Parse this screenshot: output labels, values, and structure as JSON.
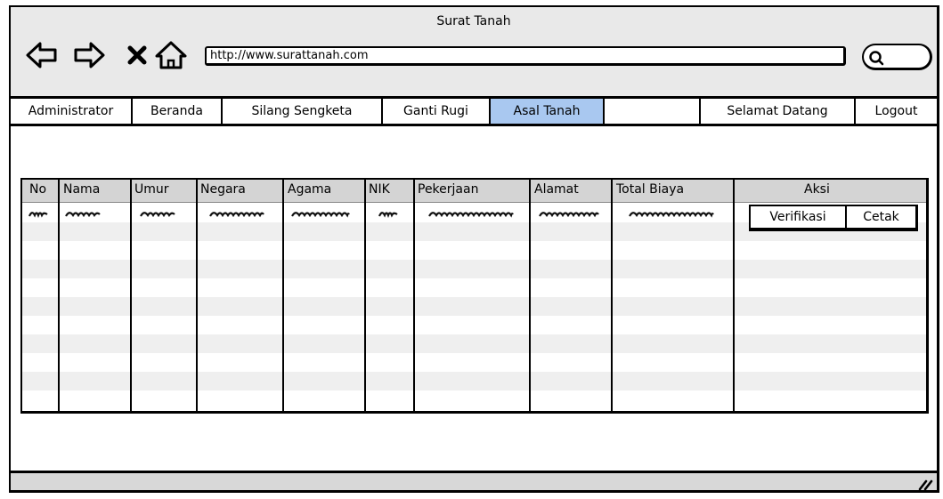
{
  "window": {
    "title": "Surat Tanah"
  },
  "browser": {
    "url": "http://www.surattanah.com",
    "icons": [
      "back-arrow-icon",
      "forward-arrow-icon",
      "close-icon",
      "home-icon",
      "search-icon"
    ]
  },
  "menu": {
    "items": [
      {
        "label": "Administrator"
      },
      {
        "label": "Beranda"
      },
      {
        "label": "Silang Sengketa"
      },
      {
        "label": "Ganti Rugi"
      },
      {
        "label": "Asal Tanah",
        "active": true
      },
      {
        "label": ""
      },
      {
        "label": "Selamat Datang"
      },
      {
        "label": "Logout"
      }
    ],
    "active_color": "#a9c8f0"
  },
  "table": {
    "columns": [
      "No",
      "Nama",
      "Umur",
      "Negara",
      "Agama",
      "NIK",
      "Pekerjaan",
      "Alamat",
      "Total Biaya",
      "Aksi"
    ],
    "actions": {
      "verify_label": "Verifikasi",
      "print_label": "Cetak"
    }
  }
}
